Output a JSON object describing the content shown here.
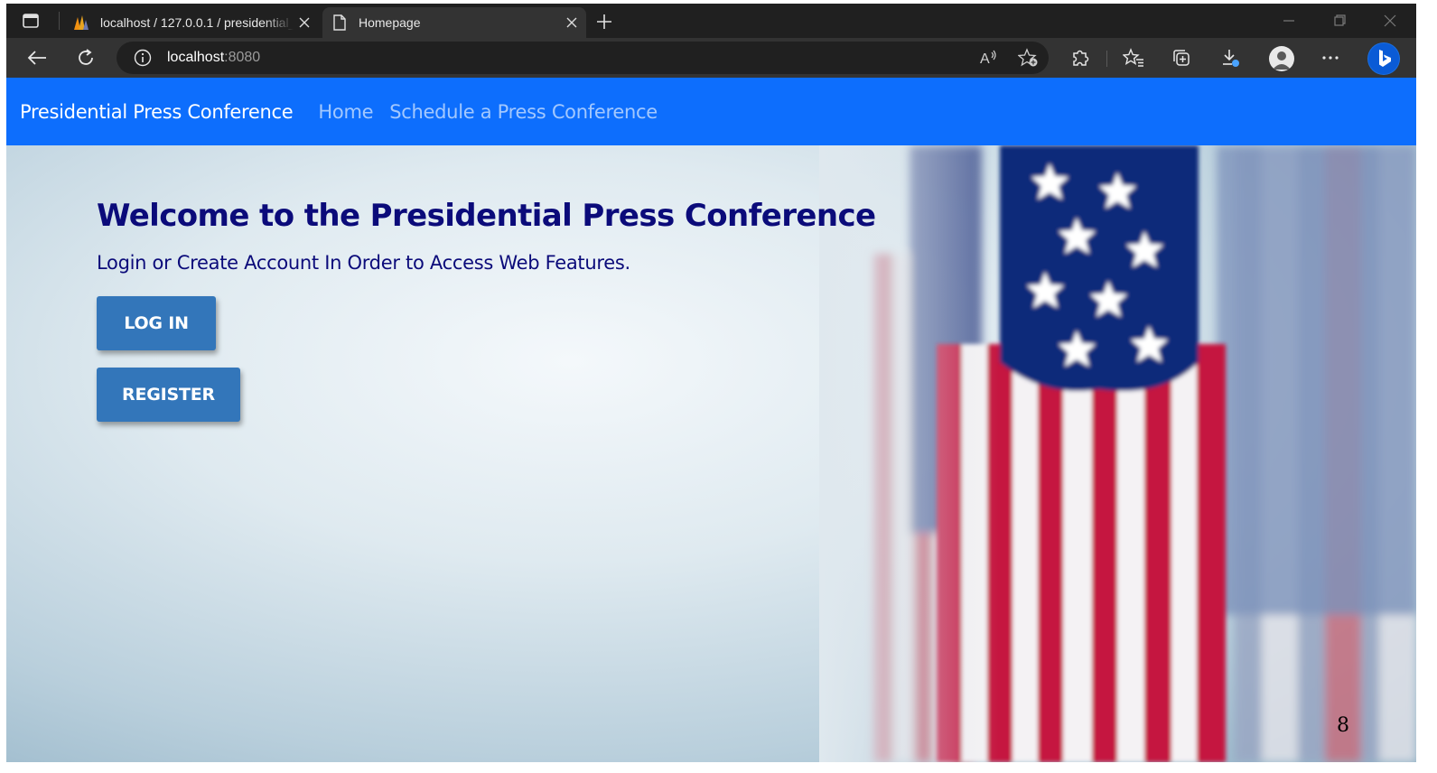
{
  "browser": {
    "tabs": [
      {
        "title": "localhost / 127.0.0.1 / presidential_press",
        "icon": "phpmyadmin-icon",
        "active": false
      },
      {
        "title": "Homepage",
        "icon": "page-icon",
        "active": true
      }
    ],
    "address": {
      "host": "localhost",
      "port": ":8080"
    },
    "toolbar_icons": [
      "back-icon",
      "refresh-icon",
      "info-icon",
      "read-aloud-icon",
      "add-favorite-icon",
      "extensions-icon",
      "favorites-icon",
      "collections-icon",
      "downloads-icon",
      "profile-icon",
      "more-icon",
      "bing-icon"
    ],
    "colors": {
      "frame": "#202020",
      "toolbar": "#333333"
    }
  },
  "navbar": {
    "brand": "Presidential Press Conference",
    "links": [
      "Home",
      "Schedule a Press Conference"
    ],
    "color": "#0d6efd"
  },
  "hero": {
    "title": "Welcome to the Presidential Press Conference",
    "subtitle": "Login or Create Account In Order to Access Web Features.",
    "buttons": {
      "login": "LOG IN",
      "register": "REGISTER"
    },
    "title_color": "#0b0b7a",
    "button_color": "#3376ba"
  },
  "page_number": "8"
}
